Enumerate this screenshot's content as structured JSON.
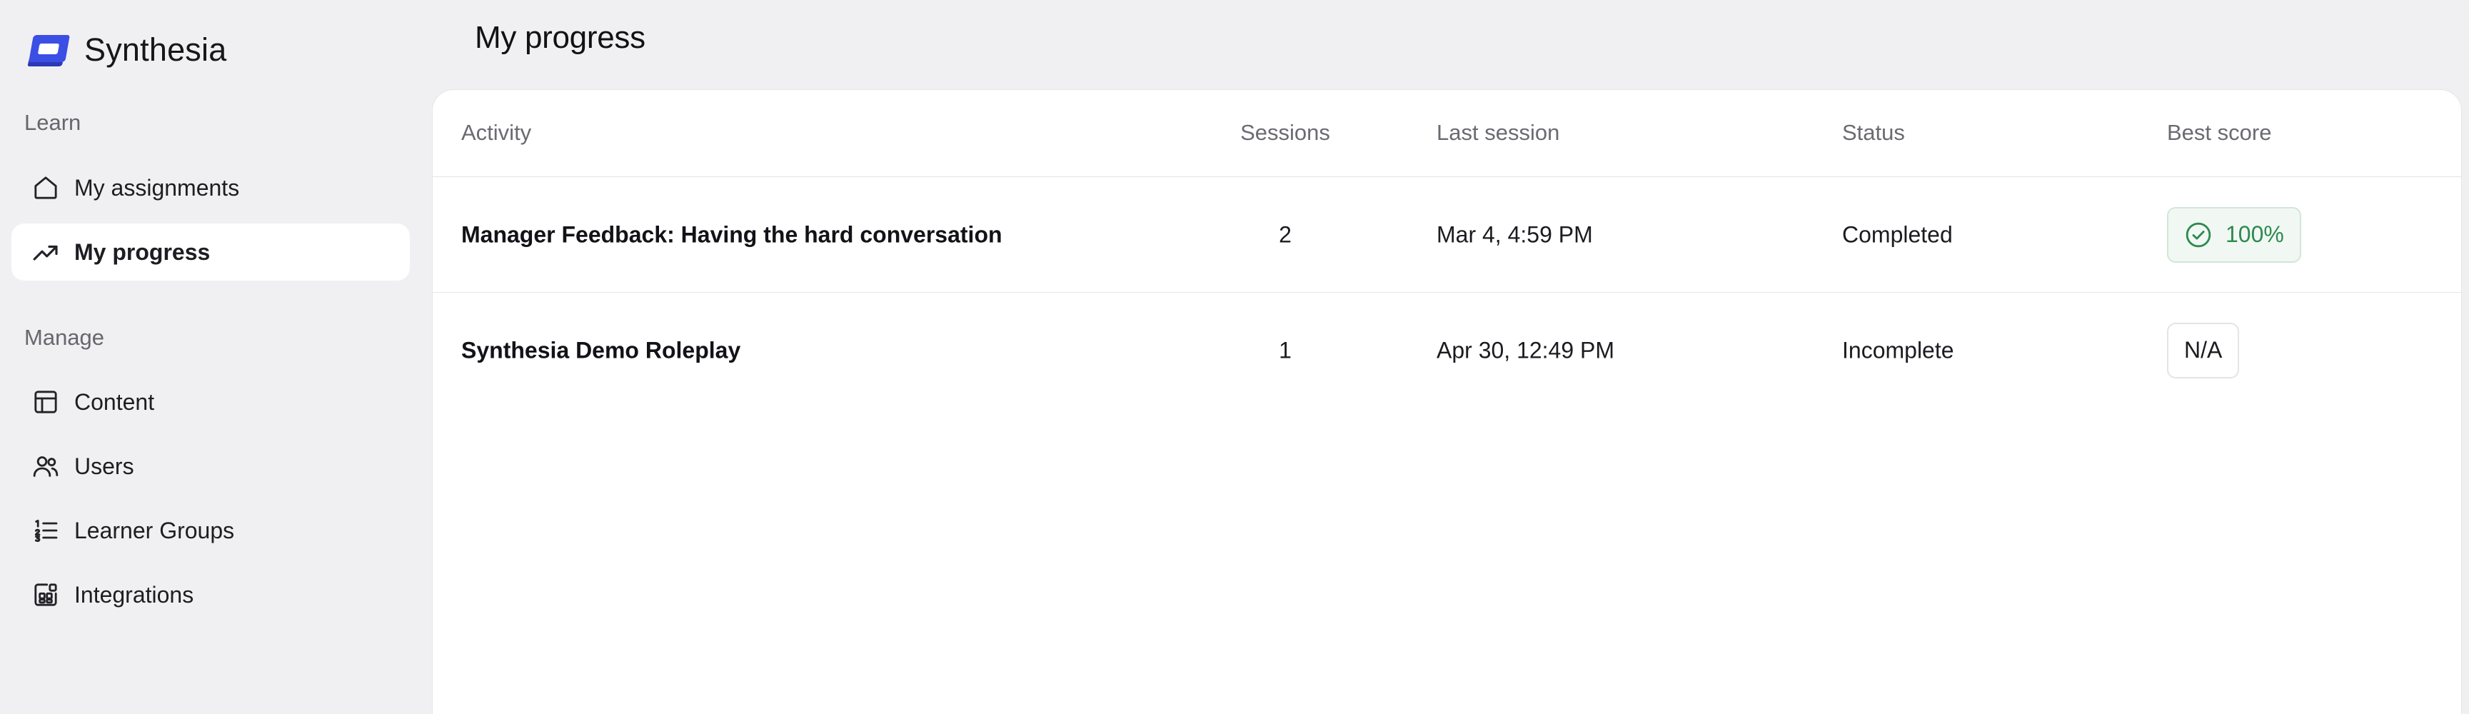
{
  "brand": {
    "name": "Synthesia",
    "accent": "#3b4fe4"
  },
  "sidebar": {
    "sections": [
      {
        "label": "Learn",
        "items": [
          {
            "label": "My assignments",
            "icon": "home-icon",
            "active": false
          },
          {
            "label": "My progress",
            "icon": "trending-up-icon",
            "active": true
          }
        ]
      },
      {
        "label": "Manage",
        "items": [
          {
            "label": "Content",
            "icon": "layout-icon",
            "active": false
          },
          {
            "label": "Users",
            "icon": "users-icon",
            "active": false
          },
          {
            "label": "Learner Groups",
            "icon": "list-ordered-icon",
            "active": false
          },
          {
            "label": "Integrations",
            "icon": "integrations-icon",
            "active": false
          }
        ]
      }
    ]
  },
  "main": {
    "title": "My progress",
    "table": {
      "columns": [
        "Activity",
        "Sessions",
        "Last session",
        "Status",
        "Best score"
      ],
      "rows": [
        {
          "activity": "Manager Feedback: Having the hard conversation",
          "sessions": "2",
          "last_session": "Mar 4, 4:59 PM",
          "status": "Completed",
          "best_score": "100%",
          "score_state": "success"
        },
        {
          "activity": "Synthesia Demo Roleplay",
          "sessions": "1",
          "last_session": "Apr 30, 12:49 PM",
          "status": "Incomplete",
          "best_score": "N/A",
          "score_state": "neutral"
        }
      ]
    }
  },
  "colors": {
    "background": "#f0f0f2",
    "panel": "#ffffff",
    "success": "#2d8a4f"
  }
}
